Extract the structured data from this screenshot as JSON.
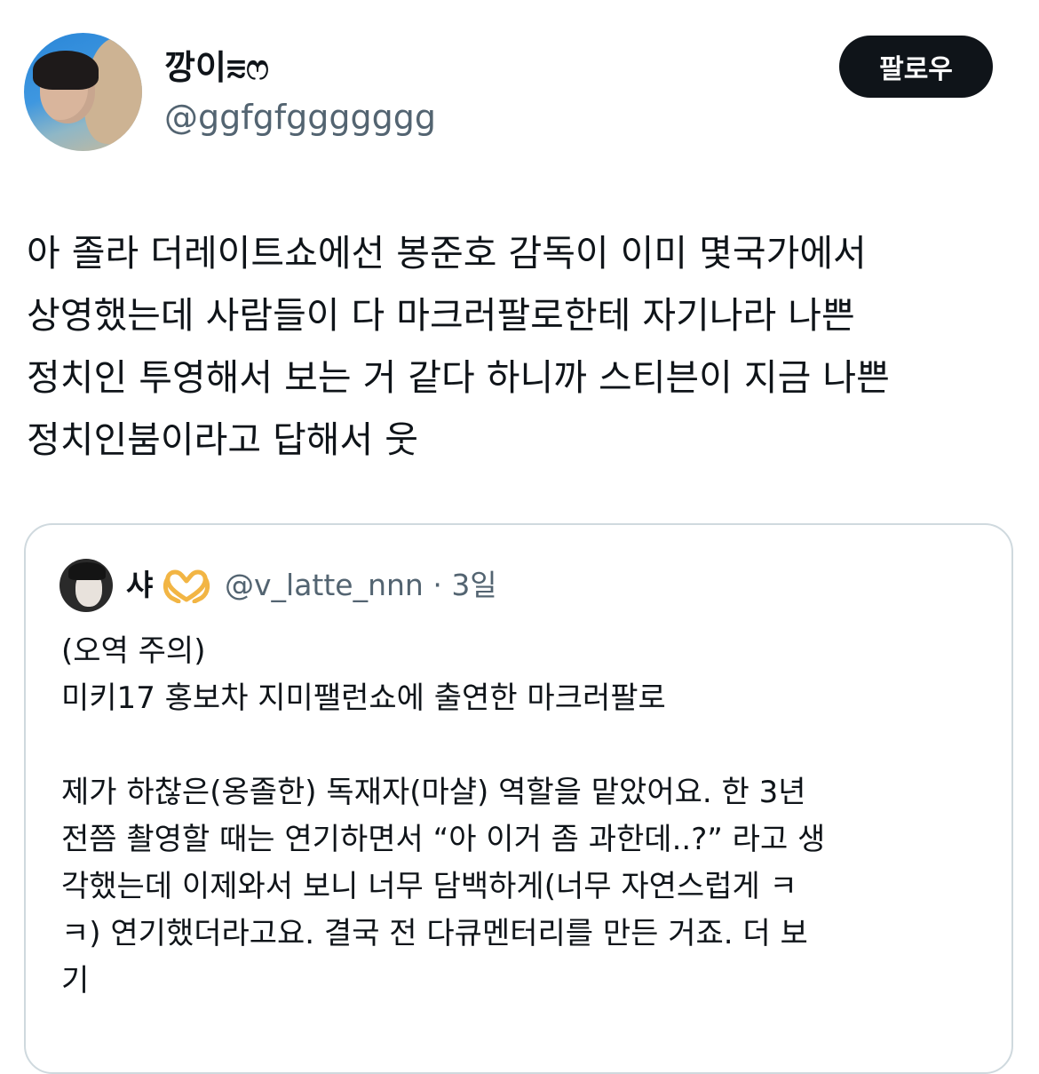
{
  "author": {
    "display_name": "깡이⩳ෆ",
    "handle": "@ggfgfggggggg",
    "avatar_icon": "profile-photo"
  },
  "follow_button": {
    "label": "팔로우"
  },
  "tweet": {
    "lines": [
      "아 졸라 더레이트쇼에선 봉준호 감독이 이미 몇국가에서",
      "상영했는데 사람들이 다 마크러팔로한테 자기나라 나쁜",
      "정치인 투영해서 보는 거 같다 하니까 스티븐이 지금 나쁜",
      "정치인붐이라고 답해서 웃"
    ]
  },
  "quote": {
    "display_name": "샤",
    "emoji": "heart-hands-icon",
    "handle_time": "@v_latte_nnn · 3일",
    "lines": [
      "(오역 주의)",
      "미키17 홍보차 지미팰런쇼에 출연한 마크러팔로",
      "",
      "제가 하찮은(옹졸한) 독재자(마샬) 역할을 맡았어요. 한 3년",
      "전쯤 촬영할 때는 연기하면서 “아 이거 좀 과한데..?” 라고 생",
      "각했는데 이제와서 보니 너무 담백하게(너무 자연스럽게 ㅋ",
      "ㅋ) 연기했더라고요. 결국 전 다큐멘터리를 만든 거죠. 더 보",
      "기"
    ]
  },
  "colors": {
    "text_primary": "#0f1419",
    "text_secondary": "#536471",
    "border": "#cfd9de",
    "button_bg": "#0f1419"
  }
}
